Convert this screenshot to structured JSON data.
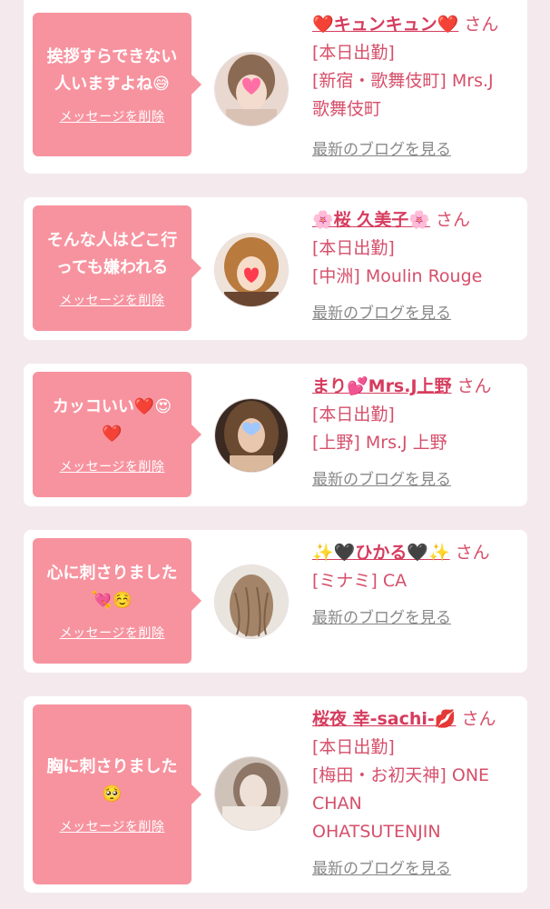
{
  "cards": [
    {
      "message": "挨拶すらできない\n人いますよね😅",
      "delete_label": "メッセージを削除",
      "cast_name": "❤️キュンキュン❤️",
      "suffix": "さん",
      "status": "[本日出勤]",
      "shop": "[新宿・歌舞伎町] Mrs.J\n歌舞伎町",
      "blog_label": "最新のブログを見る"
    },
    {
      "message": "そんな人はどこ行\nっても嫌われる",
      "delete_label": "メッセージを削除",
      "cast_name": "🌸桜 久美子🌸",
      "suffix": "さん",
      "status": "[本日出勤]",
      "shop": "[中洲] Moulin Rouge",
      "blog_label": "最新のブログを見る"
    },
    {
      "message": "カッコいい❤️😍\n❤️",
      "delete_label": "メッセージを削除",
      "cast_name": "まり💕Mrs.J上野",
      "suffix": "さん",
      "status": "[本日出勤]",
      "shop": "[上野] Mrs.J 上野",
      "blog_label": "最新のブログを見る"
    },
    {
      "message": "心に刺さりました\n💘☺️",
      "delete_label": "メッセージを削除",
      "cast_name": "✨🖤ひかる🖤✨",
      "suffix": "さん",
      "status": "",
      "shop": "[ミナミ] CA",
      "blog_label": "最新のブログを見る"
    },
    {
      "message": "胸に刺さりました\n🥺",
      "delete_label": "メッセージを削除",
      "cast_name": "桜夜 幸-sachi-💋",
      "suffix": "さん",
      "status": "[本日出勤]",
      "shop": "[梅田・お初天神] ONE\nCHAN\nOHATSUTENJIN",
      "blog_label": "最新のブログを見る"
    }
  ],
  "colors": {
    "bubble": "#f7939f",
    "accent": "#d63c5e",
    "muted_link": "#888888",
    "page_bg": "#f4e9ec"
  }
}
